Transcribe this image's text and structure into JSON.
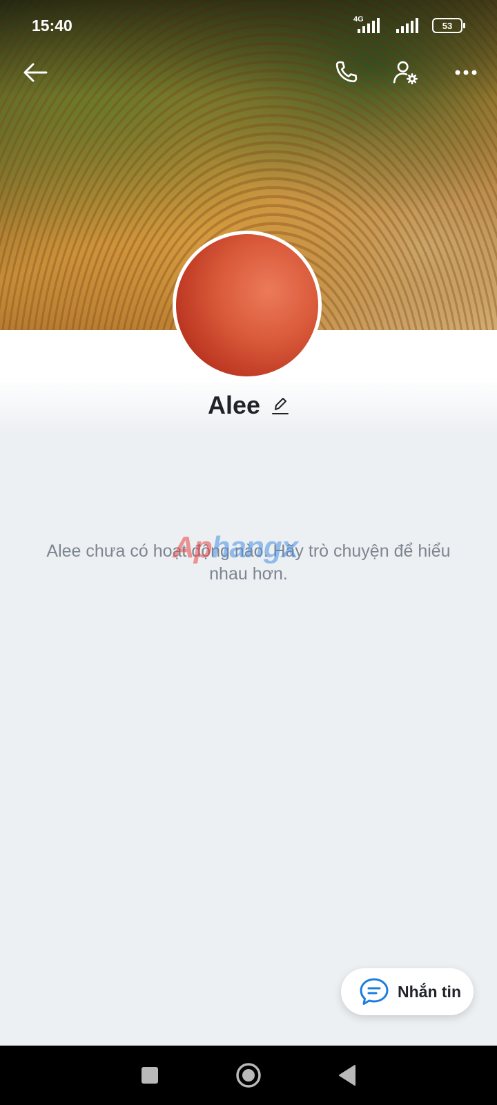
{
  "status_bar": {
    "time": "15:40",
    "network": "4G",
    "battery": "53"
  },
  "header": {
    "back_icon": "arrow-left-icon",
    "call_icon": "phone-icon",
    "settings_icon": "user-settings-icon",
    "more_icon": "more-horizontal-icon"
  },
  "profile": {
    "name": "Alee",
    "edit_icon": "pencil-icon",
    "empty_message": "Alee chưa có hoạt động nào. Hãy trò chuyện để hiểu nhau hơn."
  },
  "watermark": {
    "part1": "Ap",
    "part2": "hangx"
  },
  "message_button": {
    "label": "Nhắn tin",
    "icon": "chat-bubble-icon"
  },
  "navigation": {
    "recent_icon": "square-icon",
    "home_icon": "circle-home-icon",
    "back_icon": "triangle-back-icon"
  },
  "colors": {
    "accent": "#1a7de0",
    "background": "#edf0f3",
    "text_secondary": "#7c8590"
  }
}
